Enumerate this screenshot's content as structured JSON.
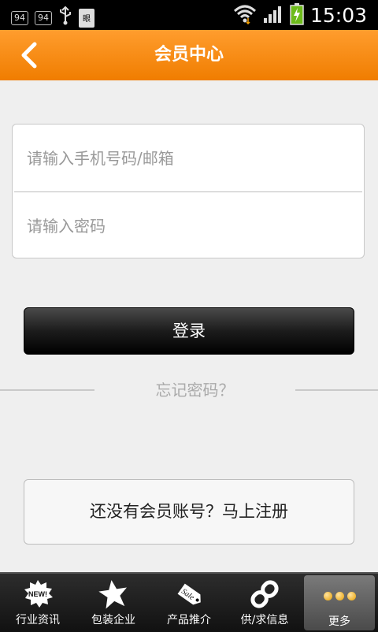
{
  "status_bar": {
    "left_badges": [
      "94",
      "94"
    ],
    "doc_label": "眼",
    "time": "15:03"
  },
  "header": {
    "title": "会员中心"
  },
  "login": {
    "phone_placeholder": "请输入手机号码/邮箱",
    "password_placeholder": "请输入密码",
    "submit_label": "登录",
    "forgot_label": "忘记密码？",
    "register_label": "还没有会员账号？马上注册"
  },
  "bottom_nav": {
    "items": [
      {
        "label": "行业资讯",
        "icon": "new-badge-icon"
      },
      {
        "label": "包装企业",
        "icon": "star-icon"
      },
      {
        "label": "产品推介",
        "icon": "sale-tag-icon"
      },
      {
        "label": "供/求信息",
        "icon": "link-icon"
      },
      {
        "label": "更多",
        "icon": "more-dots-icon"
      }
    ],
    "active_index": 4,
    "new_badge_text": "NEW!",
    "sale_tag_text": "Sale"
  },
  "colors": {
    "header_orange": "#f5860f",
    "active_dot": "#e8a000"
  }
}
